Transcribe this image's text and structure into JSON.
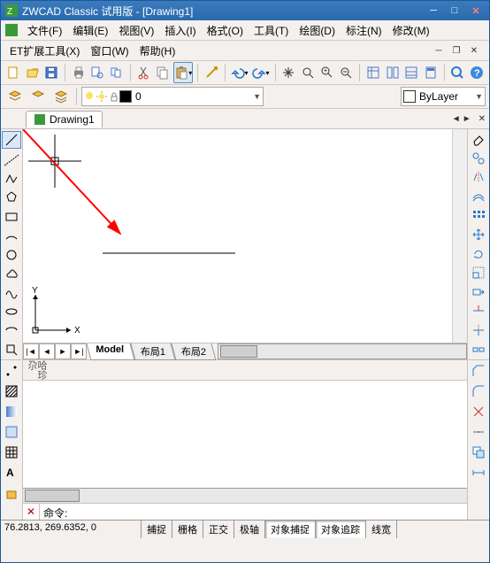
{
  "title": "ZWCAD Classic 试用版 - [Drawing1]",
  "menubar": {
    "items": [
      "文件(F)",
      "编辑(E)",
      "视图(V)",
      "插入(I)",
      "格式(O)",
      "工具(T)",
      "绘图(D)",
      "标注(N)",
      "修改(M)"
    ],
    "row2_label": "ET扩展工具(X)",
    "row2_items": [
      "窗口(W)",
      "帮助(H)"
    ]
  },
  "layer_panel": {
    "layer_dd_value": "0",
    "color_dd_value": "ByLayer"
  },
  "doc_tab": "Drawing1",
  "model_tabs": {
    "active": "Model",
    "tabs": [
      "Model",
      "布局1",
      "布局2"
    ]
  },
  "ucs": {
    "x_label": "X",
    "y_label": "Y"
  },
  "command": {
    "prompt": "命令:",
    "value": ""
  },
  "status": {
    "coords": "76.2813, 269.6352, 0",
    "buttons": [
      {
        "label": "捕捉",
        "on": false
      },
      {
        "label": "栅格",
        "on": false
      },
      {
        "label": "正交",
        "on": false
      },
      {
        "label": "极轴",
        "on": false
      },
      {
        "label": "对象捕捉",
        "on": true
      },
      {
        "label": "对象追踪",
        "on": true
      },
      {
        "label": "线宽",
        "on": false
      }
    ]
  },
  "icons": {
    "new": "new",
    "open": "open",
    "save": "save",
    "print": "print",
    "preview": "preview",
    "cut": "cut",
    "copy": "copy",
    "paste": "paste",
    "undo": "undo",
    "redo": "redo",
    "pan": "pan",
    "zoom": "zoom",
    "help": "help"
  }
}
